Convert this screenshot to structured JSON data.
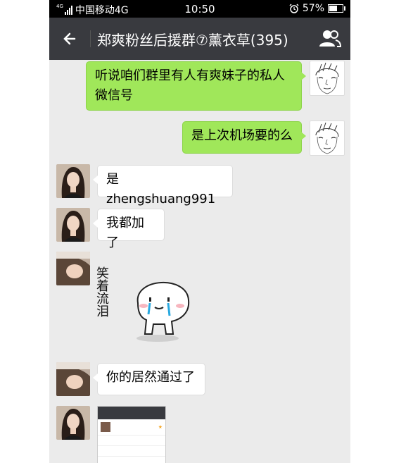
{
  "status_bar": {
    "network_badge": "4G",
    "carrier": "中国移动4G",
    "time": "10:50",
    "battery": "57%"
  },
  "header": {
    "title": "郑爽粉丝后援群⑦薰衣草(395)"
  },
  "messages": [
    {
      "side": "right",
      "text": "听说咱们群里有人有爽妹子的私人微信号",
      "avatar": "sketch-avatar"
    },
    {
      "side": "right",
      "text": "是上次机场要的么",
      "avatar": "sketch-avatar"
    },
    {
      "side": "left",
      "text": "是zhengshuang991",
      "avatar": "photo-avatar"
    },
    {
      "side": "left",
      "text": "我都加了",
      "avatar": "photo-avatar"
    },
    {
      "side": "left",
      "sticker_text": "笑着流泪",
      "avatar": "photo-avatar-2"
    },
    {
      "side": "left",
      "text": "你的居然通过了",
      "avatar": "photo-avatar-2"
    },
    {
      "side": "left",
      "image": "screenshot",
      "avatar": "photo-avatar"
    }
  ],
  "colors": {
    "chat_bg": "#ebebeb",
    "titlebar": "#393a3f",
    "sent_bubble": "#a0e75a",
    "received_bubble": "#ffffff"
  }
}
